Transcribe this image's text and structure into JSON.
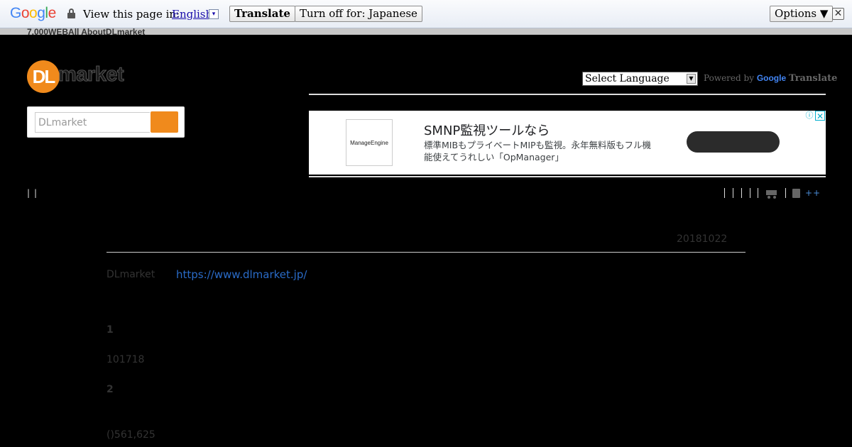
{
  "translate_bar": {
    "logo": "Google",
    "label": "View this page in:",
    "language": "English",
    "dropdown_glyph": "▾",
    "translate_btn": "Translate",
    "turn_off_btn": "Turn off for: Japanese",
    "options_btn": "Options ▼",
    "close_glyph": "✕"
  },
  "top_strip": {
    "text": "7,000WEBAll AboutDLmarket"
  },
  "header": {
    "logo_mark": "DL",
    "logo_word": "market",
    "search_placeholder": "DLmarket",
    "language_select": "Select Language",
    "select_caret": "▼",
    "powered_by": "Powered by",
    "powered_google": "Google",
    "powered_translate": "Translate"
  },
  "ad": {
    "info_glyph": "ⓘ",
    "close_glyph": "✕",
    "advertiser_logo": "ManageEngine",
    "title": "SMNP監視ツールなら",
    "description": "標準MIBもプライベートMIPも監視。永年無料版もフル機能使えてうれしい「OpManager」"
  },
  "nav": {
    "left": "||",
    "right_links": "++"
  },
  "content": {
    "date": "20181022",
    "site_label": "DLmarket",
    "site_url": "https://www.dlmarket.jp/",
    "section1_num": "1",
    "section1_value": "101718",
    "section2_num": "2",
    "section2_value": "()561,625"
  },
  "colors": {
    "brand_orange": "#f08a1c",
    "link_blue": "#2a6bc7",
    "background": "#000000"
  }
}
